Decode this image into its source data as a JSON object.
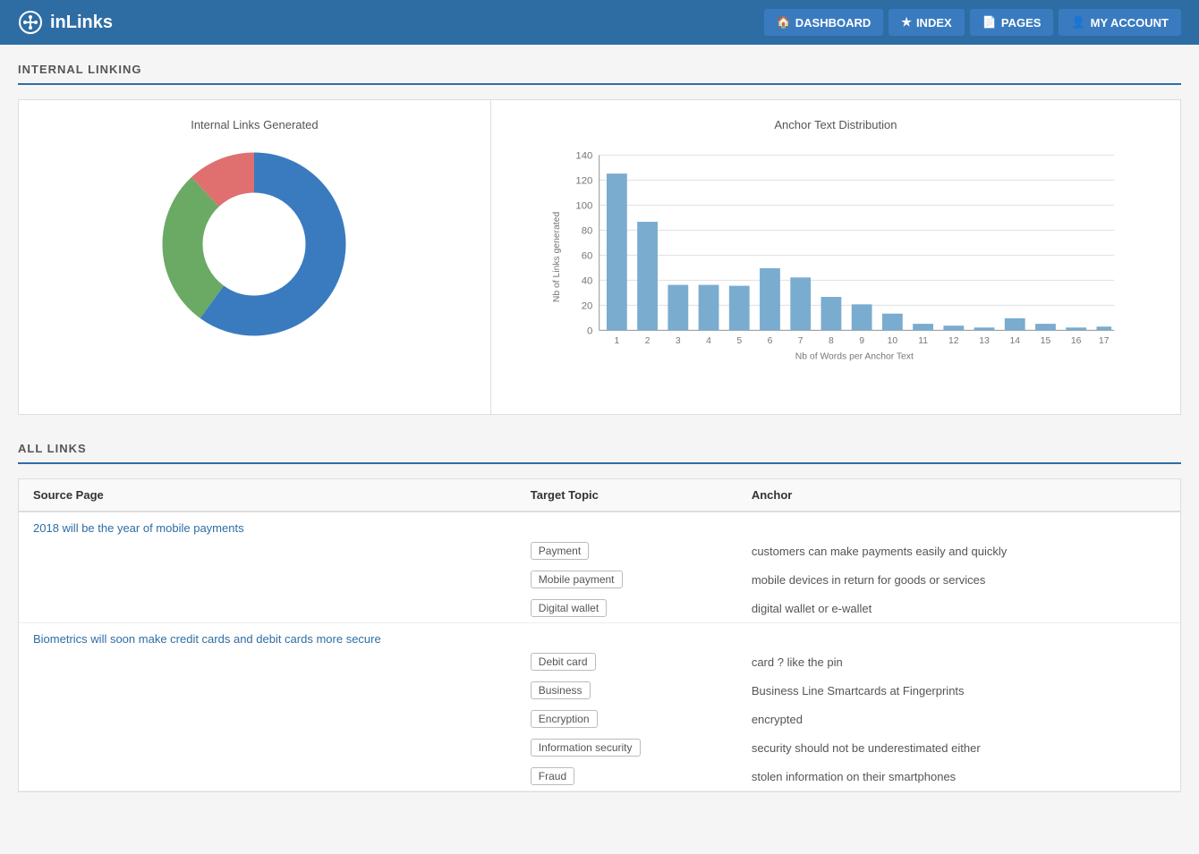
{
  "header": {
    "logo_text": "inLinks",
    "nav": [
      {
        "label": "DASHBOARD",
        "icon": "home"
      },
      {
        "label": "INDEX",
        "icon": "star"
      },
      {
        "label": "PAGES",
        "icon": "file"
      },
      {
        "label": "MY ACCOUNT",
        "icon": "user"
      }
    ]
  },
  "internal_linking": {
    "section_title": "INTERNAL LINKING",
    "donut_chart": {
      "title": "Internal Links Generated",
      "segments": [
        {
          "color": "#3a7bbf",
          "value": 60,
          "percent": 60
        },
        {
          "color": "#6aaa64",
          "value": 28,
          "percent": 28
        },
        {
          "color": "#e07070",
          "value": 12,
          "percent": 12
        }
      ]
    },
    "bar_chart": {
      "title": "Anchor Text Distribution",
      "y_label": "Nb of Links generated",
      "x_label": "Nb of Words per Anchor Text",
      "bars": [
        {
          "x": 1,
          "value": 125
        },
        {
          "x": 2,
          "value": 87
        },
        {
          "x": 3,
          "value": 36
        },
        {
          "x": 4,
          "value": 36
        },
        {
          "x": 5,
          "value": 35
        },
        {
          "x": 6,
          "value": 50
        },
        {
          "x": 7,
          "value": 42
        },
        {
          "x": 8,
          "value": 27
        },
        {
          "x": 9,
          "value": 21
        },
        {
          "x": 10,
          "value": 13
        },
        {
          "x": 11,
          "value": 5
        },
        {
          "x": 12,
          "value": 4
        },
        {
          "x": 13,
          "value": 2
        },
        {
          "x": 14,
          "value": 10
        },
        {
          "x": 15,
          "value": 5
        },
        {
          "x": 16,
          "value": 2
        },
        {
          "x": 17,
          "value": 3
        }
      ],
      "y_max": 140,
      "y_ticks": [
        0,
        20,
        40,
        60,
        80,
        100,
        120,
        140
      ]
    }
  },
  "all_links": {
    "section_title": "ALL LINKS",
    "columns": [
      "Source Page",
      "Target Topic",
      "Anchor"
    ],
    "rows": [
      {
        "source": "2018 will be the year of mobile payments",
        "source_url": "#",
        "entries": [
          {
            "topic": "Payment",
            "anchor": "customers can make payments easily and quickly"
          },
          {
            "topic": "Mobile payment",
            "anchor": "mobile devices in return for goods or services"
          },
          {
            "topic": "Digital wallet",
            "anchor": "digital wallet or e-wallet"
          }
        ]
      },
      {
        "source": "Biometrics will soon make credit cards and debit cards more secure",
        "source_url": "#",
        "entries": [
          {
            "topic": "Debit card",
            "anchor": "card ? like the pin"
          },
          {
            "topic": "Business",
            "anchor": "Business Line Smartcards at Fingerprints"
          },
          {
            "topic": "Encryption",
            "anchor": "encrypted"
          },
          {
            "topic": "Information security",
            "anchor": "security should not be underestimated either"
          },
          {
            "topic": "Fraud",
            "anchor": "stolen information on their smartphones"
          }
        ]
      }
    ]
  }
}
